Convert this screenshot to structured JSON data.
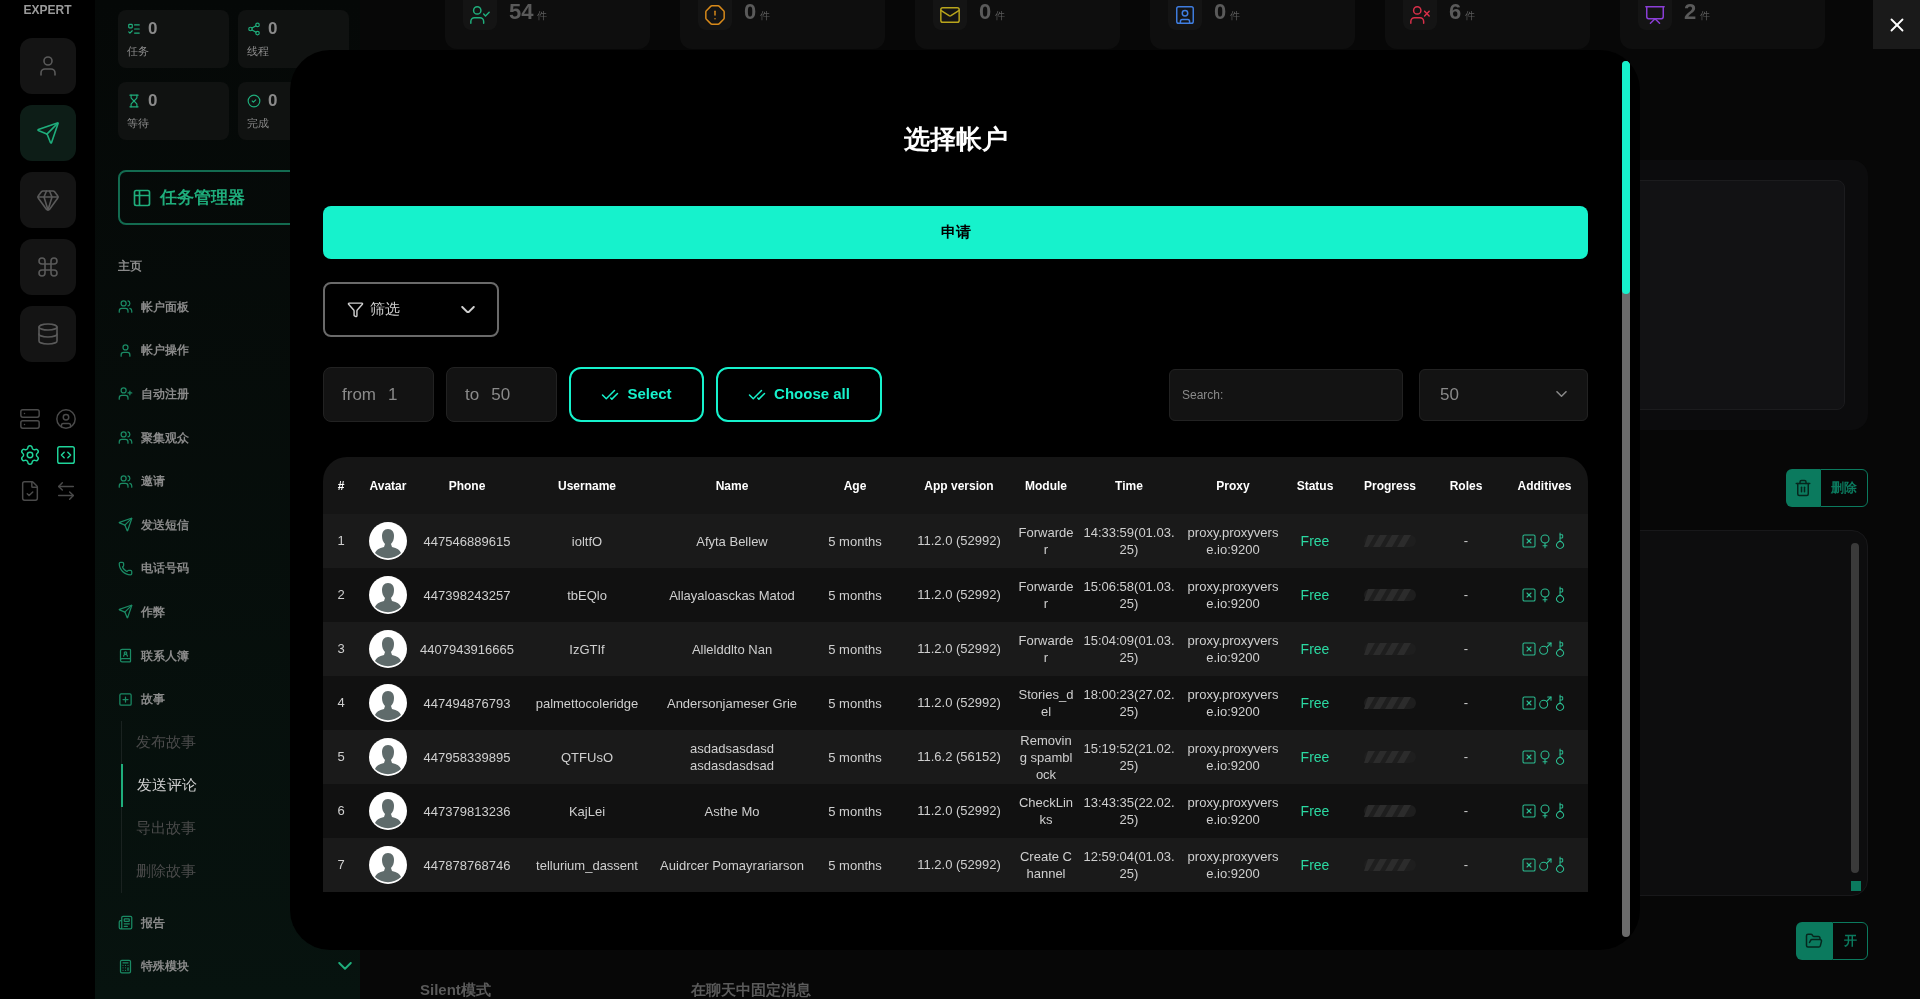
{
  "rail": {
    "logo": "EXPERT",
    "buttons": [
      {
        "selected": false
      },
      {
        "selected": true
      },
      {
        "selected": false
      },
      {
        "selected": false
      },
      {
        "selected": false
      }
    ],
    "tools": [
      {
        "active": false
      },
      {
        "active": false
      },
      {
        "active": true
      },
      {
        "active": true
      },
      {
        "active": false
      },
      {
        "active": false
      }
    ]
  },
  "sidebar": {
    "stats": [
      {
        "value": "0",
        "label": "任务"
      },
      {
        "value": "0",
        "label": "线程"
      },
      {
        "value": "0",
        "label": "等待"
      },
      {
        "value": "0",
        "label": "完成"
      }
    ],
    "manager_button": "任务管理器",
    "section": "主页",
    "items": [
      {
        "label": "帐户面板"
      },
      {
        "label": "帐户操作"
      },
      {
        "label": "自动注册"
      },
      {
        "label": "聚集观众"
      },
      {
        "label": "邀请"
      },
      {
        "label": "发送短信"
      },
      {
        "label": "电话号码"
      },
      {
        "label": "作弊"
      },
      {
        "label": "联系人簿"
      },
      {
        "label": "故事",
        "expanded": true,
        "children": [
          {
            "label": "发布故事",
            "selected": false
          },
          {
            "label": "发送评论",
            "selected": true
          },
          {
            "label": "导出故事",
            "selected": false
          },
          {
            "label": "删除故事",
            "selected": false
          }
        ]
      },
      {
        "label": "报告"
      },
      {
        "label": "特殊模块",
        "expanded": false
      }
    ]
  },
  "top_cards": [
    {
      "value": "54",
      "unit": "件",
      "color": "#1fae7c"
    },
    {
      "value": "0",
      "unit": "件",
      "color": "#d98a1a"
    },
    {
      "value": "0",
      "unit": "件",
      "color": "#b9a51c"
    },
    {
      "value": "0",
      "unit": "件",
      "color": "#3f7de0"
    },
    {
      "value": "6",
      "unit": "件",
      "color": "#d9304a"
    },
    {
      "value": "2",
      "unit": "件",
      "color": "#8c3fd9"
    }
  ],
  "right_panel": {
    "delete_button": "删除",
    "open_button": "开"
  },
  "bottom_labels": [
    "Silent模式",
    "在聊天中固定消息"
  ],
  "modal": {
    "title": "选择帐户",
    "apply_button": "申请",
    "filter": "筛选",
    "from": {
      "label": "from",
      "value": "1"
    },
    "to": {
      "label": "to",
      "value": "50"
    },
    "select_button": "Select",
    "choose_all_button": "Choose all",
    "search": {
      "placeholder": "Search:"
    },
    "page_size": "50",
    "table": {
      "columns": [
        "#",
        "Avatar",
        "Phone",
        "Username",
        "Name",
        "Age",
        "App version",
        "Module",
        "Time",
        "Proxy",
        "Status",
        "Progress",
        "Roles",
        "Additives"
      ],
      "rows": [
        {
          "index": "1",
          "phone": "447546889615",
          "username": "ioltfO",
          "name": "Afyta Bellew",
          "age": "5 months",
          "app_version": "11.2.0 (52992)",
          "module": "Forwarder",
          "time": "14:33:59(01.03.25)",
          "proxy": "proxy.proxyverse.io:9200",
          "status": "Free",
          "roles": "-",
          "kind": "female"
        },
        {
          "index": "2",
          "phone": "447398243257",
          "username": "tbEQlo",
          "name": "Allayaloasckas Matod",
          "age": "5 months",
          "app_version": "11.2.0 (52992)",
          "module": "Forwarder",
          "time": "15:06:58(01.03.25)",
          "proxy": "proxy.proxyverse.io:9200",
          "status": "Free",
          "roles": "-",
          "kind": "female"
        },
        {
          "index": "3",
          "phone": "4407943916665",
          "username": "IzGTIf",
          "name": "Allelddlto Nan",
          "age": "5 months",
          "app_version": "11.2.0 (52992)",
          "module": "Forwarder",
          "time": "15:04:09(01.03.25)",
          "proxy": "proxy.proxyverse.io:9200",
          "status": "Free",
          "roles": "-",
          "kind": "male"
        },
        {
          "index": "4",
          "phone": "447494876793",
          "username": "palmettocoleridge",
          "name": "Andersonjameser Grie",
          "age": "5 months",
          "app_version": "11.2.0 (52992)",
          "module": "Stories_del",
          "time": "18:00:23(27.02.25)",
          "proxy": "proxy.proxyverse.io:9200",
          "status": "Free",
          "roles": "-",
          "kind": "male"
        },
        {
          "index": "5",
          "phone": "447958339895",
          "username": "QTFUsO",
          "name": "asdadsasdasd asdasdasdsad",
          "age": "5 months",
          "app_version": "11.6.2 (56152)",
          "module": "Removing spamblock",
          "time": "15:19:52(21.02.25)",
          "proxy": "proxy.proxyverse.io:9200",
          "status": "Free",
          "roles": "-",
          "kind": "female"
        },
        {
          "index": "6",
          "phone": "447379813236",
          "username": "KajLei",
          "name": "Asthe Mo",
          "age": "5 months",
          "app_version": "11.2.0 (52992)",
          "module": "CheckLinks",
          "time": "13:43:35(22.02.25)",
          "proxy": "proxy.proxyverse.io:9200",
          "status": "Free",
          "roles": "-",
          "kind": "female"
        },
        {
          "index": "7",
          "phone": "447878768746",
          "username": "tellurium_dassent",
          "name": "Auidrcer Pomayrariarson",
          "age": "5 months",
          "app_version": "11.2.0 (52992)",
          "module": "Create Channel",
          "time": "12:59:04(01.03.25)",
          "proxy": "proxy.proxyverse.io:9200",
          "status": "Free",
          "roles": "-",
          "kind": "male"
        }
      ]
    }
  }
}
